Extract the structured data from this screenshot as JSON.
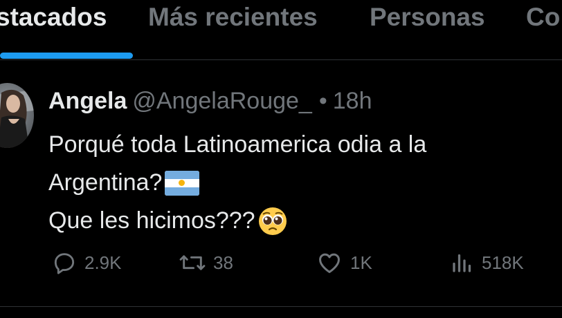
{
  "tabs": {
    "items": [
      {
        "label": "stacados"
      },
      {
        "label": "Más recientes"
      },
      {
        "label": "Personas"
      },
      {
        "label": "Co"
      }
    ],
    "active_index": 0
  },
  "tweet": {
    "name": "Angela",
    "handle": "@AngelaRouge_",
    "separator": "•",
    "time": "18h",
    "lines": [
      "Porqué toda Latinoamerica odia a la",
      "Argentina?",
      "Que les hicimos???"
    ],
    "inline_emoji": {
      "line_2": "argentina-flag",
      "line_3": "pleading-face"
    },
    "stats": {
      "replies": "2.9K",
      "reposts": "38",
      "likes": "1K",
      "views": "518K"
    }
  },
  "colors": {
    "background": "#000000",
    "text": "#e7e9ea",
    "muted": "#71767b",
    "accent": "#1d9bf0",
    "divider": "#2f3336"
  },
  "icons": [
    "reply-icon",
    "repost-icon",
    "like-icon",
    "views-icon"
  ]
}
